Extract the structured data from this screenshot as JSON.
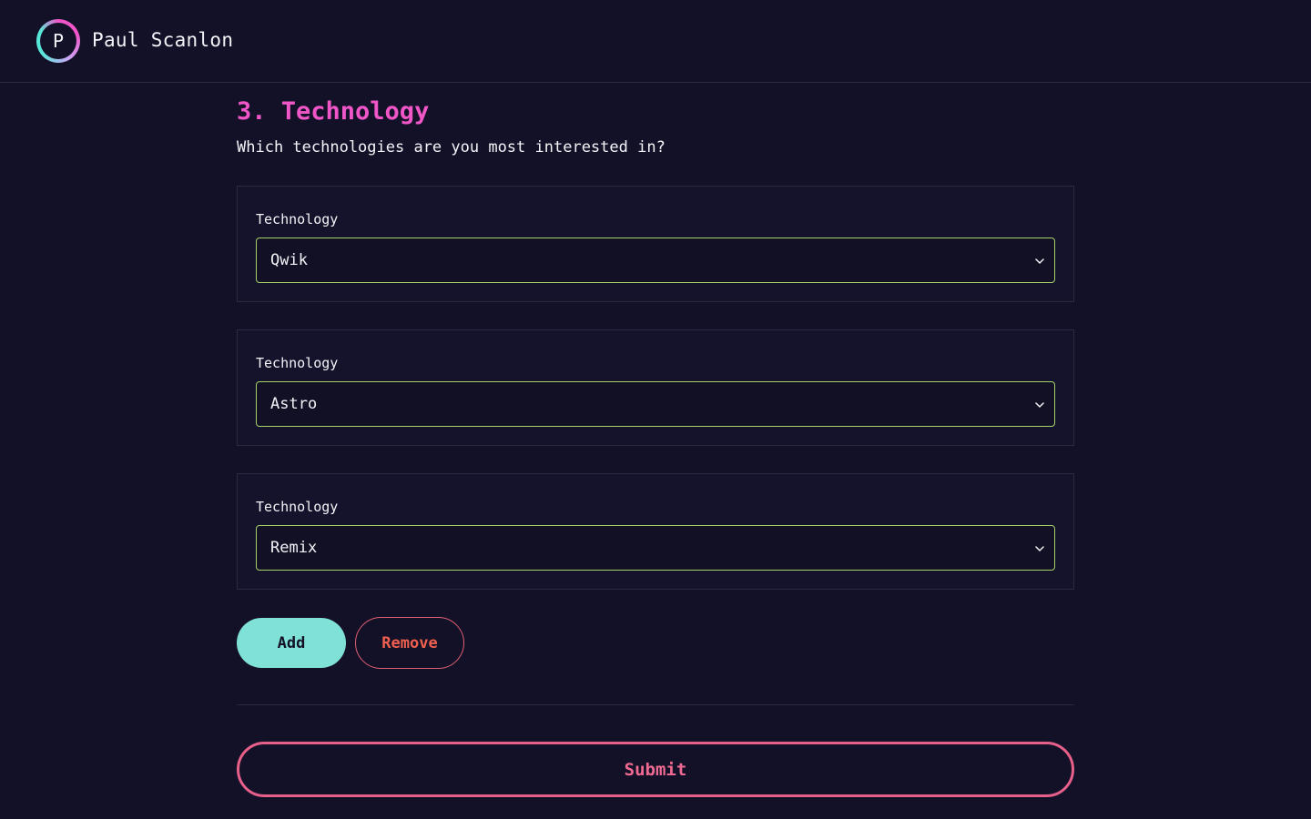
{
  "header": {
    "logo_letter": "P",
    "site_name": "Paul Scanlon"
  },
  "section": {
    "title": "3. Technology",
    "subtitle": "Which technologies are you most interested in?"
  },
  "fields": [
    {
      "label": "Technology",
      "value": "Qwik"
    },
    {
      "label": "Technology",
      "value": "Astro"
    },
    {
      "label": "Technology",
      "value": "Remix"
    }
  ],
  "actions": {
    "add_label": "Add",
    "remove_label": "Remove",
    "submit_label": "Submit"
  },
  "colors": {
    "background": "#131127",
    "accent_pink": "#f056c7",
    "select_border": "#a6d26a",
    "add_button": "#7fe1d8",
    "remove_text": "#f0604f",
    "submit_border": "#e7608a"
  },
  "icons": {
    "select_caret": "chevron-down-icon"
  }
}
